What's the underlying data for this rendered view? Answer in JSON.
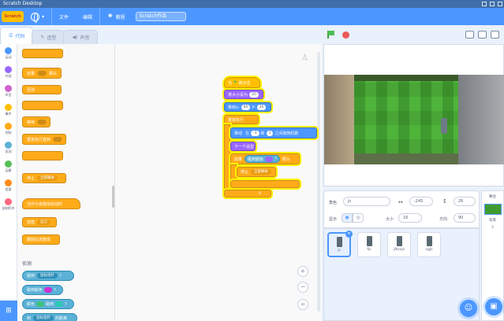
{
  "window": {
    "title": "Scratch Desktop"
  },
  "menubar": {
    "logo_text": "Scratch",
    "file": "文件",
    "edit": "编辑",
    "tutorials": "教程",
    "project_title": "Scratch作品"
  },
  "tabs": {
    "code": "代码",
    "costumes": "造型",
    "sounds": "声音"
  },
  "categories": [
    {
      "label": "运动",
      "color": "#4c97ff"
    },
    {
      "label": "外观",
      "color": "#9966ff"
    },
    {
      "label": "声音",
      "color": "#cf63cf"
    },
    {
      "label": "事件",
      "color": "#ffbf00"
    },
    {
      "label": "控制",
      "color": "#ffab19"
    },
    {
      "label": "侦测",
      "color": "#5cb1d6"
    },
    {
      "label": "运算",
      "color": "#59c059"
    },
    {
      "label": "变量",
      "color": "#ff8c1a"
    },
    {
      "label": "自制积木",
      "color": "#ff6680"
    }
  ],
  "palette": {
    "if_then": "如果",
    "then": "那么",
    "else": "否则",
    "wait_until": "等待",
    "repeat_until": "重复执行直到",
    "stop": "停止",
    "stop_opt": "全部脚本",
    "when_clone": "当作为克隆体启动时",
    "create_clone": "克隆",
    "clone_opt": "自己",
    "delete_clone": "删除此克隆体",
    "sensing_title": "侦测",
    "touching": "碰到",
    "touching_opt": "鼠标指针",
    "touching_color": "碰到颜色",
    "color_touching": "颜色",
    "color_touching_mid": "碰到",
    "distance": "到",
    "distance_opt": "鼠标指针",
    "distance_tail": "的距离"
  },
  "script": {
    "hat": "当",
    "hat_tail": "被点击",
    "set_size": "将大小设为",
    "size_value": "20",
    "goto": "移到x:",
    "goto_x": "80",
    "goto_y_label": "y:",
    "goto_y": "26",
    "forever": "重复执行",
    "glide_a": "移动",
    "glide_in": "在",
    "glide_between": "和",
    "glide_tail": "之间取随机数",
    "glide_from": "-3",
    "glide_to": "3",
    "next_costume": "下一个造型",
    "if": "如果",
    "if_cond": "碰到颜色",
    "if_then": "那么",
    "stop": "停止",
    "stop_opt": "全部脚本"
  },
  "sprite_info": {
    "name_label": "角色",
    "name_value": "js",
    "x_value": "-245",
    "y_value": "26",
    "show_label": "显示",
    "size_label": "大小",
    "size_value": "16",
    "direction_label": "方向",
    "direction_value": "90"
  },
  "sprites": [
    {
      "name": "js",
      "selected": true
    },
    {
      "name": "fjs",
      "selected": false
    },
    {
      "name": "jfkcsjs",
      "selected": false
    },
    {
      "name": "cgjs",
      "selected": false
    }
  ],
  "stage_pane": {
    "title": "舞台",
    "backdrops_label": "背景",
    "backdrops_count": "2"
  },
  "zoom": {
    "in": "+",
    "out": "−",
    "reset": "="
  }
}
